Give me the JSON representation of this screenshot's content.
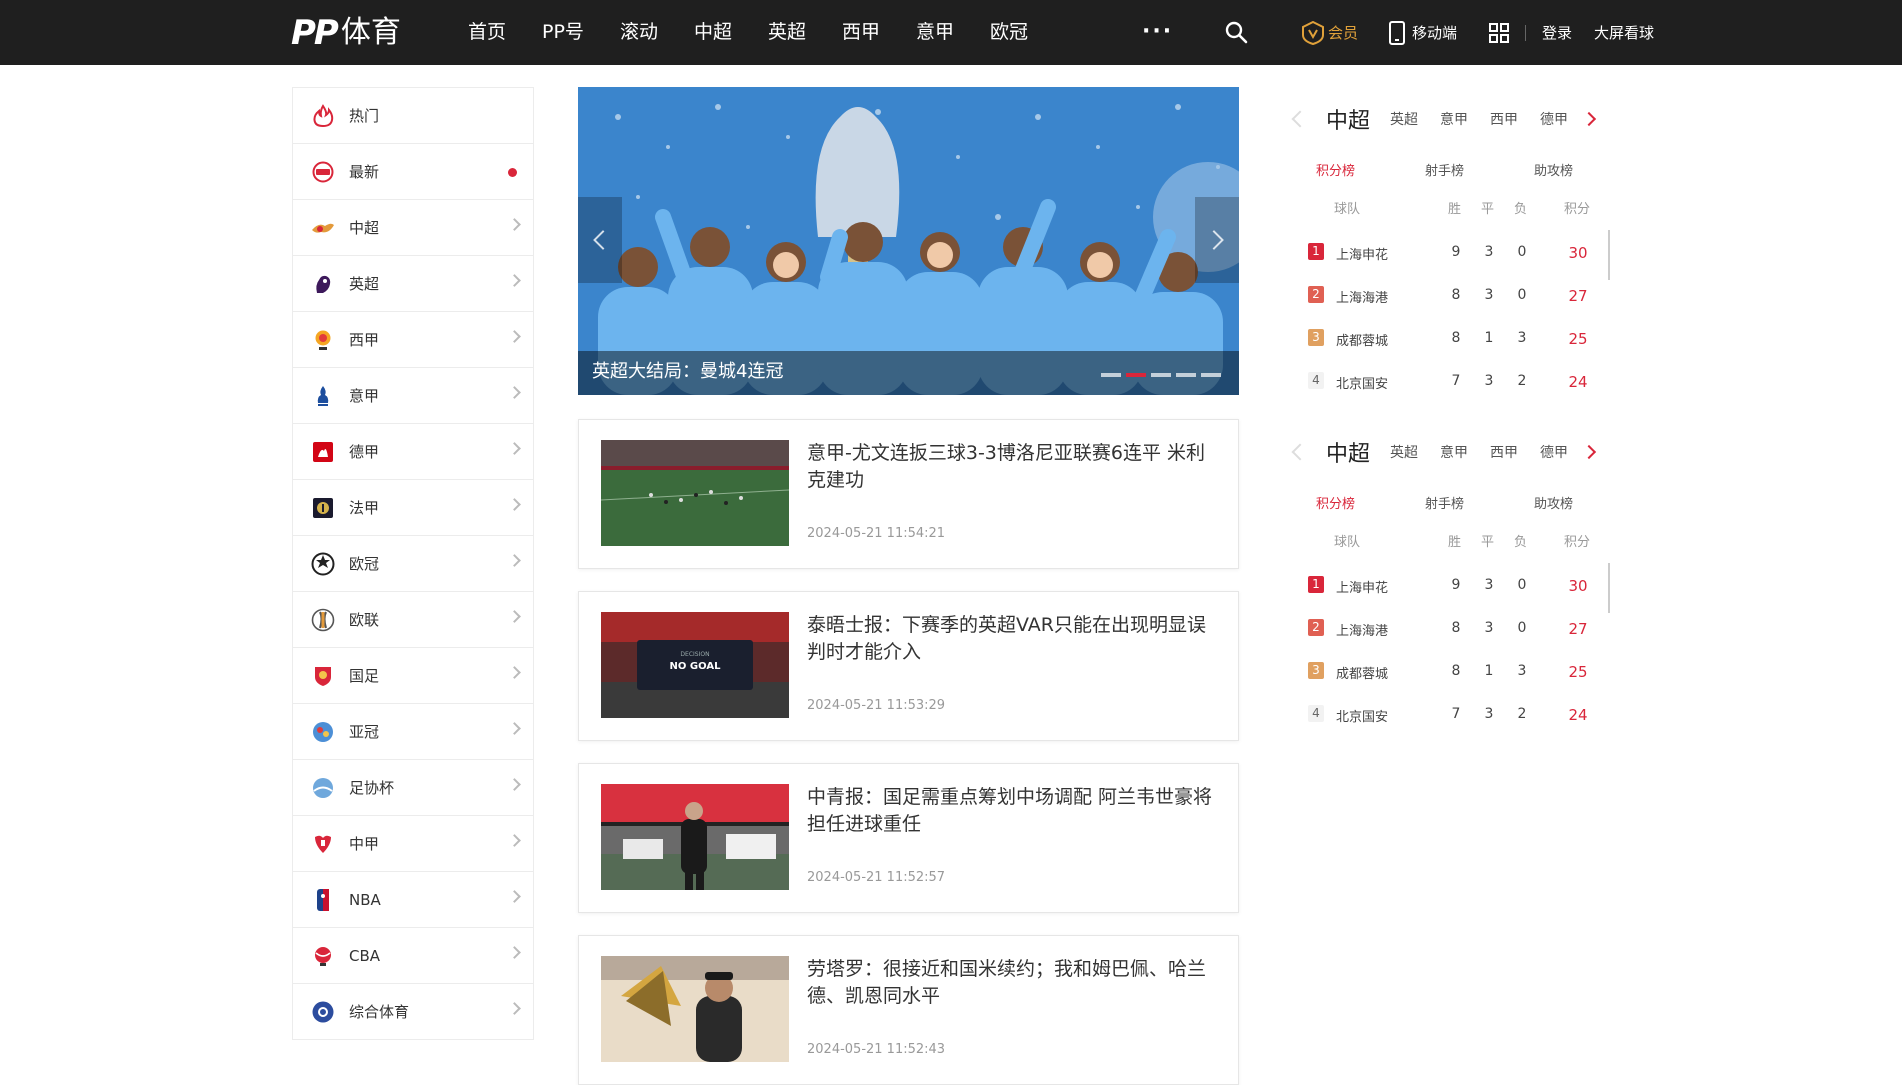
{
  "header": {
    "logo_pp": "PP",
    "logo_text": "体育",
    "nav": [
      "首页",
      "PP号",
      "滚动",
      "中超",
      "英超",
      "西甲",
      "意甲",
      "欧冠"
    ],
    "more": "···",
    "vip": "会员",
    "mobile": "移动端",
    "login": "登录",
    "bigscreen": "大屏看球"
  },
  "sidebar": {
    "items": [
      {
        "label": "热门",
        "icon": "flame-icon"
      },
      {
        "label": "最新",
        "icon": "new-badge-icon"
      },
      {
        "label": "中超",
        "icon": "csl-logo-icon"
      },
      {
        "label": "英超",
        "icon": "premier-league-lion-icon"
      },
      {
        "label": "西甲",
        "icon": "laliga-logo-icon"
      },
      {
        "label": "意甲",
        "icon": "serie-a-logo-icon"
      },
      {
        "label": "德甲",
        "icon": "bundesliga-logo-icon"
      },
      {
        "label": "法甲",
        "icon": "ligue1-logo-icon"
      },
      {
        "label": "欧冠",
        "icon": "champions-league-ball-icon"
      },
      {
        "label": "欧联",
        "icon": "europa-league-trophy-icon"
      },
      {
        "label": "国足",
        "icon": "china-national-team-icon"
      },
      {
        "label": "亚冠",
        "icon": "afc-champions-league-icon"
      },
      {
        "label": "足协杯",
        "icon": "fa-cup-icon"
      },
      {
        "label": "中甲",
        "icon": "china-league-one-icon"
      },
      {
        "label": "NBA",
        "icon": "nba-logo-icon"
      },
      {
        "label": "CBA",
        "icon": "cba-logo-icon"
      },
      {
        "label": "综合体育",
        "icon": "multi-sport-icon"
      }
    ]
  },
  "hero": {
    "title": "英超大结局：曼城4连冠",
    "active_dot": 1,
    "dots": 5
  },
  "news": [
    {
      "title": "意甲-尤文连扳三球3-3博洛尼亚联赛6连平 米利克建功",
      "time": "2024-05-21 11:54:21"
    },
    {
      "title": "泰晤士报：下赛季的英超VAR只能在出现明显误判时才能介入",
      "time": "2024-05-21 11:53:29",
      "thumb_text_top": "DECISION",
      "thumb_text": "NO GOAL"
    },
    {
      "title": "中青报：国足需重点筹划中场调配 阿兰韦世豪将担任进球重任",
      "time": "2024-05-21 11:52:57"
    },
    {
      "title": "劳塔罗：很接近和国米续约；我和姆巴佩、哈兰德、凯恩同水平",
      "time": "2024-05-21 11:52:43"
    }
  ],
  "standings_widgets": [
    {
      "tabs": [
        "中超",
        "英超",
        "意甲",
        "西甲",
        "德甲"
      ],
      "subtabs": [
        "积分榜",
        "射手榜",
        "助攻榜"
      ],
      "columns": {
        "team": "球队",
        "w": "胜",
        "d": "平",
        "l": "负",
        "pts": "积分"
      },
      "rows": [
        {
          "rank": "1",
          "team": "上海申花",
          "w": "9",
          "d": "3",
          "l": "0",
          "pts": "30"
        },
        {
          "rank": "2",
          "team": "上海海港",
          "w": "8",
          "d": "3",
          "l": "0",
          "pts": "27"
        },
        {
          "rank": "3",
          "team": "成都蓉城",
          "w": "8",
          "d": "1",
          "l": "3",
          "pts": "25"
        },
        {
          "rank": "4",
          "team": "北京国安",
          "w": "7",
          "d": "3",
          "l": "2",
          "pts": "24"
        }
      ]
    },
    {
      "tabs": [
        "中超",
        "英超",
        "意甲",
        "西甲",
        "德甲"
      ],
      "subtabs": [
        "积分榜",
        "射手榜",
        "助攻榜"
      ],
      "columns": {
        "team": "球队",
        "w": "胜",
        "d": "平",
        "l": "负",
        "pts": "积分"
      },
      "rows": [
        {
          "rank": "1",
          "team": "上海申花",
          "w": "9",
          "d": "3",
          "l": "0",
          "pts": "30"
        },
        {
          "rank": "2",
          "team": "上海海港",
          "w": "8",
          "d": "3",
          "l": "0",
          "pts": "27"
        },
        {
          "rank": "3",
          "team": "成都蓉城",
          "w": "8",
          "d": "1",
          "l": "3",
          "pts": "25"
        },
        {
          "rank": "4",
          "team": "北京国安",
          "w": "7",
          "d": "3",
          "l": "2",
          "pts": "24"
        }
      ]
    }
  ],
  "colors": {
    "accent": "#d9263a",
    "header_bg": "#1f1f1f",
    "vip": "#e0a13a"
  }
}
